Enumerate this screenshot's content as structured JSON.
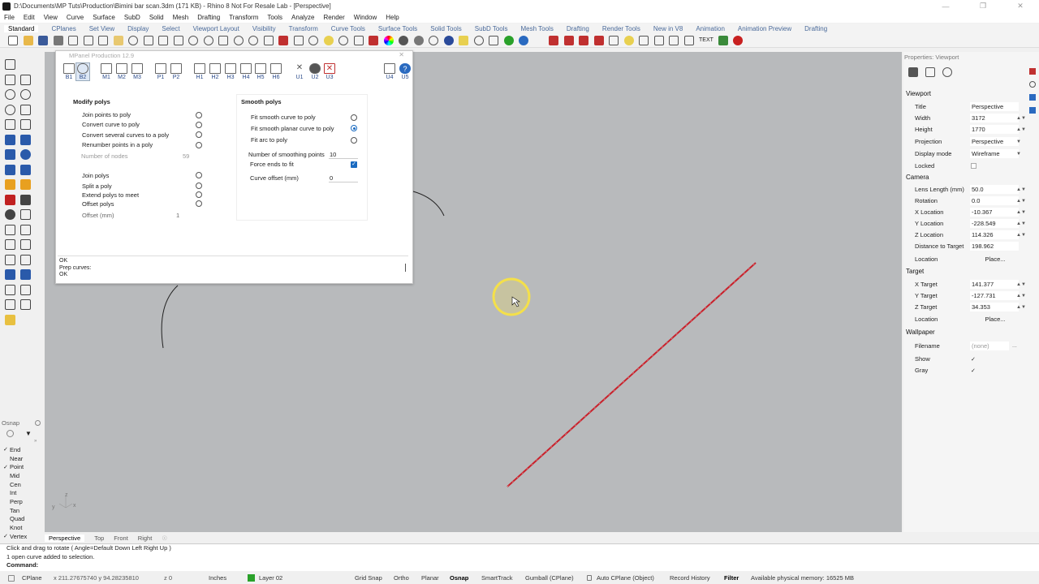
{
  "window": {
    "title": "D:\\Documents\\MP Tuts\\Production\\Bimini bar scan.3dm (171 KB) - Rhino 8 Not For Resale Lab - [Perspective]"
  },
  "menu": [
    "File",
    "Edit",
    "View",
    "Curve",
    "Surface",
    "SubD",
    "Solid",
    "Mesh",
    "Drafting",
    "Transform",
    "Tools",
    "Analyze",
    "Render",
    "Window",
    "Help"
  ],
  "toolbar_tabs": [
    "Standard",
    "CPlanes",
    "Set View",
    "Display",
    "Select",
    "Viewport Layout",
    "Visibility",
    "Transform",
    "Curve Tools",
    "Surface Tools",
    "Solid Tools",
    "SubD Tools",
    "Mesh Tools",
    "Drafting",
    "Render Tools",
    "New in V8",
    "Animation",
    "Animation Preview",
    "Drafting"
  ],
  "toolbar_text_button": "TEXT",
  "mpanel": {
    "title": "MPanel Production 12.9",
    "buttons": [
      "B1",
      "B2",
      "M1",
      "M2",
      "M3",
      "P1",
      "P2",
      "H1",
      "H2",
      "H3",
      "H4",
      "H5",
      "H6",
      "U1",
      "U2",
      "U3",
      "U4",
      "U5"
    ],
    "modify": {
      "heading": "Modify polys",
      "items": [
        "Join points to poly",
        "Convert curve to poly",
        "Convert several curves to a poly",
        "Renumber points in a poly"
      ],
      "nodes_label": "Number of nodes",
      "nodes_value": "59",
      "items2": [
        "Join polys",
        "Split a poly",
        "Extend polys to meet",
        "Offset polys"
      ],
      "offset_label": "Offset (mm)",
      "offset_value": "1"
    },
    "smooth": {
      "heading": "Smooth polys",
      "items": [
        "Fit smooth curve to poly",
        "Fit smooth planar curve to poly",
        "Fit arc to poly"
      ],
      "smoothing_label": "Number of smoothing points",
      "smoothing_value": "10",
      "force_label": "Force ends to fit",
      "curve_offset_label": "Curve offset (mm)",
      "curve_offset_value": "0"
    },
    "output": [
      "OK",
      "Prep curves:",
      "OK"
    ]
  },
  "osnap": {
    "title": "Osnap",
    "items": [
      {
        "label": "End",
        "checked": true
      },
      {
        "label": "Near",
        "checked": false
      },
      {
        "label": "Point",
        "checked": true
      },
      {
        "label": "Mid",
        "checked": false
      },
      {
        "label": "Cen",
        "checked": false
      },
      {
        "label": "Int",
        "checked": false
      },
      {
        "label": "Perp",
        "checked": false
      },
      {
        "label": "Tan",
        "checked": false
      },
      {
        "label": "Quad",
        "checked": false
      },
      {
        "label": "Knot",
        "checked": false
      },
      {
        "label": "Vertex",
        "checked": true
      }
    ]
  },
  "viewport_tabs": [
    "Perspective",
    "Top",
    "Front",
    "Right"
  ],
  "properties": {
    "title": "Properties: Viewport",
    "viewport_heading": "Viewport",
    "title_label": "Title",
    "title_value": "Perspective",
    "width_label": "Width",
    "width_value": "3172",
    "height_label": "Height",
    "height_value": "1770",
    "projection_label": "Projection",
    "projection_value": "Perspective",
    "display_label": "Display mode",
    "display_value": "Wireframe",
    "locked_label": "Locked",
    "camera_heading": "Camera",
    "lens_label": "Lens Length (mm)",
    "lens_value": "50.0",
    "rotation_label": "Rotation",
    "rotation_value": "0.0",
    "xloc_label": "X Location",
    "xloc_value": "-10.367",
    "yloc_label": "Y Location",
    "yloc_value": "-228.549",
    "zloc_label": "Z Location",
    "zloc_value": "114.326",
    "dist_label": "Distance to Target",
    "dist_value": "198.962",
    "location_label": "Location",
    "place_label": "Place...",
    "target_heading": "Target",
    "xt_label": "X Target",
    "xt_value": "141.377",
    "yt_label": "Y Target",
    "yt_value": "-127.731",
    "zt_label": "Z Target",
    "zt_value": "34.353",
    "wallpaper_heading": "Wallpaper",
    "filename_label": "Filename",
    "filename_value": "(none)",
    "show_label": "Show",
    "gray_label": "Gray",
    "ellipsis": "..."
  },
  "command": {
    "line1": "Click and drag to rotate ( Angle=Default  Down  Left  Right  Up )",
    "line2": "1 open curve added to selection.",
    "prompt": "Command:"
  },
  "status": {
    "cplane": "CPlane",
    "coords": "x 211.27675740  y 94.28235810",
    "z": "z 0",
    "units": "Inches",
    "layer": "Layer 02",
    "grid": "Grid Snap",
    "ortho": "Ortho",
    "planar": "Planar",
    "osnap": "Osnap",
    "smarttrack": "SmartTrack",
    "gumball": "Gumball (CPlane)",
    "autocplane": "Auto CPlane (Object)",
    "history": "Record History",
    "filter": "Filter",
    "memory": "Available physical memory: 16525 MB"
  },
  "axis": {
    "x": "x",
    "y": "y",
    "z": "z"
  },
  "colors": {
    "accent": "#1a6ac0",
    "viewport_bg": "#b8babc",
    "curve": "#c8202a",
    "cursor_ring": "#f4e04a",
    "layer_swatch": "#2aa12a"
  }
}
